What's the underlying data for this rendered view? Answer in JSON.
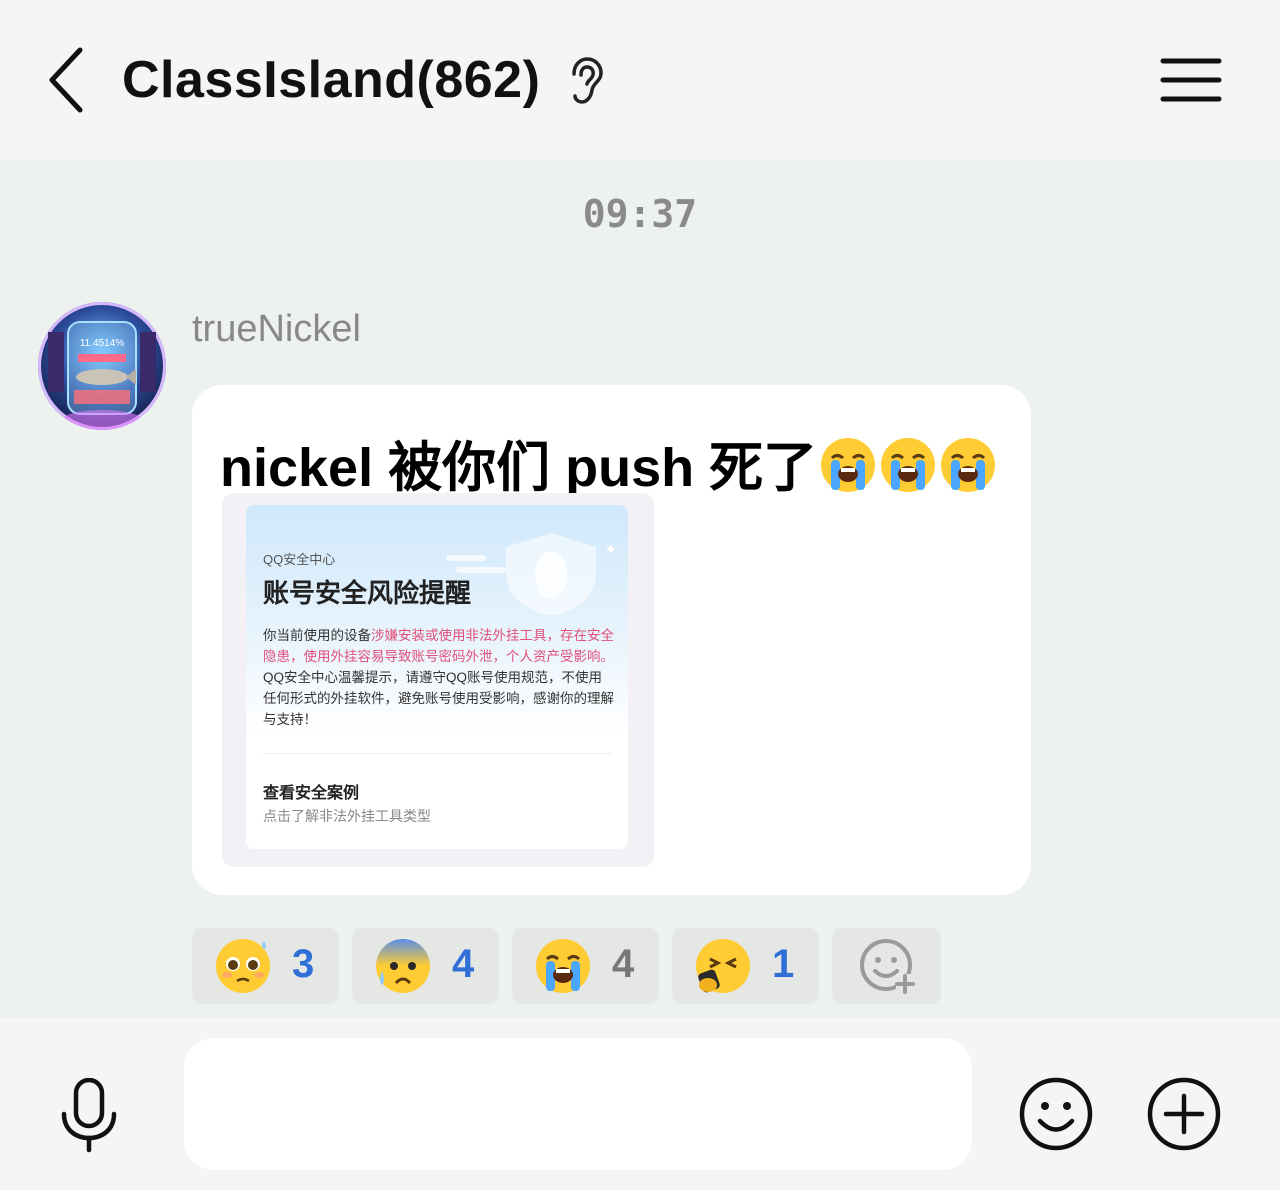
{
  "header": {
    "title": "ClassIsland(862)",
    "back_icon": "chevron-left-icon",
    "listen_icon": "ear-icon",
    "menu_icon": "hamburger-menu-icon"
  },
  "chat": {
    "timestamp": "09:37",
    "message": {
      "sender": "trueNickel",
      "text": "nickel 被你们 push 死了",
      "trailing_emojis": [
        "loudly-crying-face",
        "loudly-crying-face",
        "loudly-crying-face"
      ],
      "avatar_overlay_text": "11.4514%",
      "card": {
        "source": "QQ安全中心",
        "title": "账号安全风险提醒",
        "body_before": "你当前使用的设备",
        "body_highlight": "涉嫌安装或使用非法外挂工具，存在安全隐患，使用外挂容易导致账号密码外泄，个人资产受影响。",
        "body_after": "QQ安全中心温馨提示，请遵守QQ账号使用规范，不使用任何形式的外挂软件，避免账号使用受影响，感谢你的理解与支持！",
        "link_title": "查看安全案例",
        "link_subtitle": "点击了解非法外挂工具类型"
      }
    },
    "reactions": [
      {
        "emoji": "pleading-face",
        "count": "3",
        "count_color": "#2f6fd6"
      },
      {
        "emoji": "anxious-face-with-sweat",
        "count": "4",
        "count_color": "#2f6fd6"
      },
      {
        "emoji": "loudly-crying-face",
        "count": "4",
        "count_color": "#777777"
      },
      {
        "emoji": "face-with-phone-angry",
        "count": "1",
        "count_color": "#2f6fd6"
      }
    ],
    "add_reaction_icon": "add-reaction-icon"
  },
  "composer": {
    "input_value": "",
    "mic_icon": "microphone-icon",
    "emoji_icon": "smiley-icon",
    "plus_icon": "plus-circle-icon"
  },
  "colors": {
    "background": "#eef2ee",
    "bar": "#f5f5f5",
    "highlight": "#e0507a",
    "accent_blue": "#2f6fd6"
  }
}
